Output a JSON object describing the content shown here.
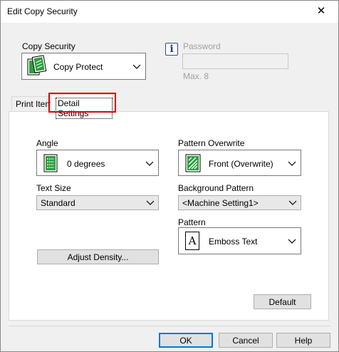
{
  "window": {
    "title": "Edit Copy Security",
    "close_glyph": "✕"
  },
  "copy_security": {
    "label": "Copy Security",
    "value": "Copy Protect"
  },
  "password": {
    "info_glyph": "i",
    "label": "Password",
    "max_text": "Max. 8"
  },
  "tabs": [
    {
      "label": "Print Item"
    },
    {
      "label": "Detail Settings"
    }
  ],
  "detail": {
    "angle": {
      "label": "Angle",
      "value": "0 degrees"
    },
    "text_size": {
      "label": "Text Size",
      "value": "Standard"
    },
    "pattern_overwrite": {
      "label": "Pattern Overwrite",
      "value": "Front (Overwrite)"
    },
    "background_pattern": {
      "label": "Background Pattern",
      "value": "<Machine Setting1>"
    },
    "pattern": {
      "label": "Pattern",
      "value": "Emboss Text",
      "icon_glyph": "A"
    },
    "adjust_density": "Adjust Density...",
    "default_button": "Default"
  },
  "buttons": {
    "ok": "OK",
    "cancel": "Cancel",
    "help": "Help"
  },
  "colors": {
    "highlight": "#e00000",
    "accent": "#0078d7",
    "green_icon": "#2e9e3e"
  }
}
